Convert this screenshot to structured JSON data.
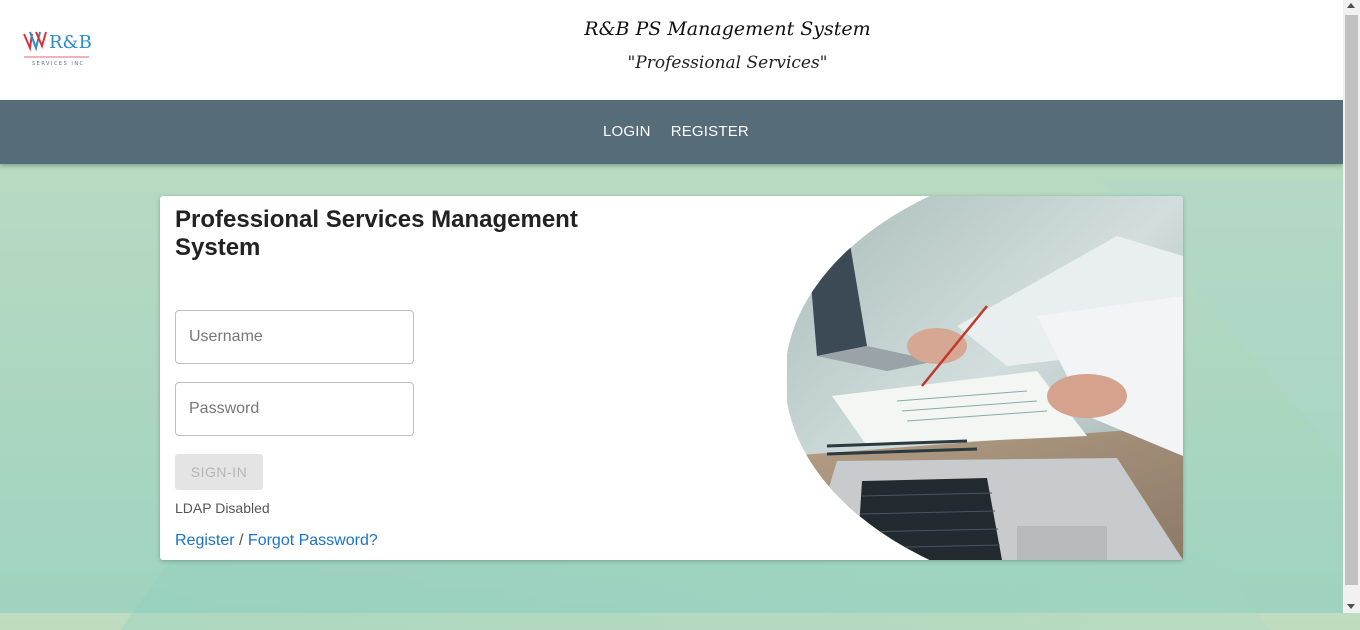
{
  "header": {
    "logo_text": "R&B",
    "logo_subtext": "SERVICES INC",
    "title": "R&B PS Management System",
    "subtitle": "\"Professional Services\""
  },
  "nav": {
    "items": [
      {
        "label": "LOGIN"
      },
      {
        "label": "REGISTER"
      }
    ]
  },
  "login": {
    "title": "Professional Services Management System",
    "username_placeholder": "Username",
    "password_placeholder": "Password",
    "signin_label": "SIGN-IN",
    "ldap_status": "LDAP Disabled",
    "register_link": "Register",
    "separator": " / ",
    "forgot_link": "Forgot Password?"
  },
  "colors": {
    "nav_bg": "#566c78",
    "link": "#1a73c8",
    "logo_red": "#d9323c",
    "logo_blue": "#2b8cc8"
  }
}
